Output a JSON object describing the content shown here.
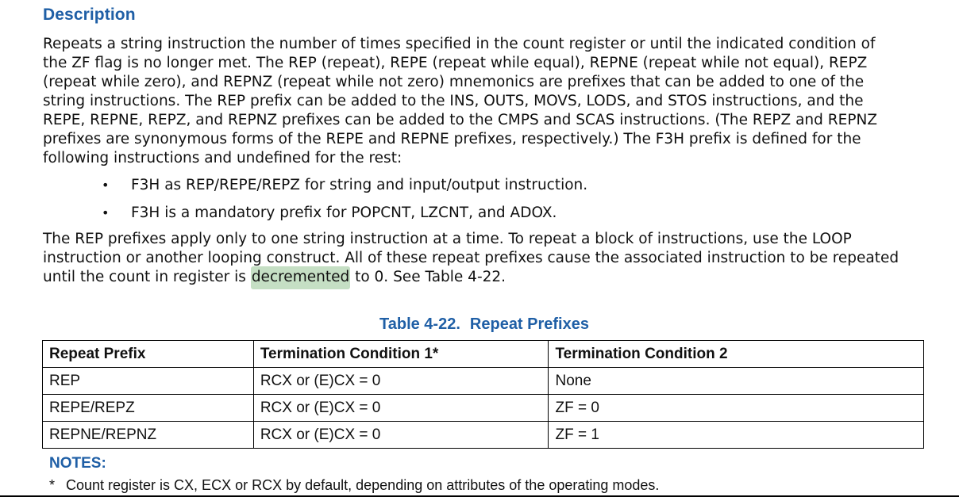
{
  "heading": "Description",
  "paragraph1": [
    "Repeats a string instruction the number of times specified in the count register or until the indicated condition of",
    "the ZF flag is no longer met. The REP (repeat), REPE (repeat while equal), REPNE (repeat while not equal), REPZ",
    "(repeat while zero), and REPNZ (repeat while not zero) mnemonics are prefixes that can be added to one of the",
    "string instructions. The REP prefix can be added to the INS, OUTS, MOVS, LODS, and STOS instructions, and the",
    "REPE, REPNE, REPZ, and REPNZ prefixes can be added to the CMPS and SCAS instructions. (The REPZ and REPNZ",
    "prefixes are synonymous forms of the REPE and REPNE prefixes, respectively.) The F3H prefix is defined for the",
    "following instructions and undefined for the rest:"
  ],
  "bullets": [
    "F3H as REP/REPE/REPZ for string and input/output instruction.",
    "F3H is a mandatory prefix for POPCNT, LZCNT, and ADOX."
  ],
  "bullet_glyph": "•",
  "paragraph2": {
    "line1": "The REP prefixes apply only to one string instruction at a time. To repeat a block of instructions, use the LOOP",
    "line2": "instruction or another looping construct. All of these repeat prefixes cause the associated instruction to be repeated",
    "line3_before": "until the count in register is ",
    "line3_highlight": "decremented",
    "line3_after": " to 0. See Table 4-22."
  },
  "table": {
    "caption_number": "Table 4-22.",
    "caption_title": "Repeat Prefixes",
    "headers": [
      "Repeat Prefix",
      "Termination Condition 1*",
      "Termination Condition 2"
    ],
    "rows": [
      [
        "REP",
        "RCX or (E)CX = 0",
        "None"
      ],
      [
        "REPE/REPZ",
        "RCX or (E)CX = 0",
        "ZF = 0"
      ],
      [
        "REPNE/REPNZ",
        "RCX or (E)CX = 0",
        "ZF = 1"
      ]
    ]
  },
  "notes": {
    "title": "NOTES:",
    "marker": "*",
    "text": "Count register is CX, ECX or RCX by default, depending on attributes of the operating modes."
  },
  "colors": {
    "heading": "#1f5fa6",
    "highlight": "#c5dfc4"
  }
}
